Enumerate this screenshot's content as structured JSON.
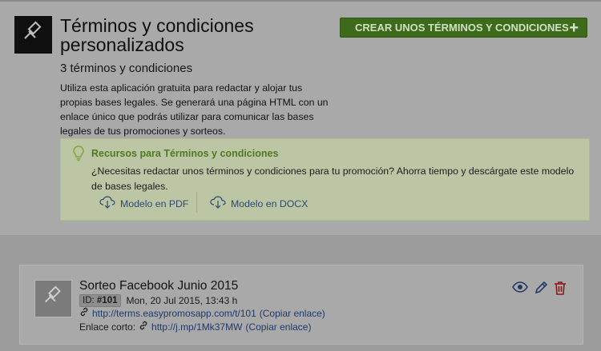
{
  "header": {
    "title": "Términos y condiciones personalizados",
    "create_button_label": "CREAR UNOS TÉRMINOS Y CONDICIONES",
    "create_button_icon": "plus-icon",
    "count_text": "3 términos y condiciones",
    "description": "Utiliza esta aplicación gratuita para redactar y alojar tus propias bases legales. Se generará una página HTML con un enlace único que podrás utilizar para comunicar las bases legales de tus promociones y sorteos."
  },
  "resources": {
    "title": "Recursos para Términos y condiciones",
    "text": "¿Necesitas redactar unos términos y condiciones para tu promoción? Ahorra tiempo y descárgate este modelo de bases legales.",
    "pdf_label": "Modelo en PDF",
    "docx_label": "Modelo en DOCX"
  },
  "items": [
    {
      "title": "Sorteo Facebook Junio 2015",
      "id_label": "ID:",
      "id_value": "#101",
      "date": "Mon, 20 Jul 2015, 13:43 h",
      "url": "http://terms.easypromosapp.com/t/101",
      "copy_label": "(Copiar enlace)",
      "short_label": "Enlace corto:",
      "short_url": "http://j.mp/1Mk37MW",
      "short_copy_label": "(Copiar enlace)"
    }
  ],
  "colors": {
    "accent_green": "#3d6b1b",
    "resource_title": "#4e7a1f",
    "link": "#1f3a6a",
    "delete": "#8b1a1a"
  }
}
